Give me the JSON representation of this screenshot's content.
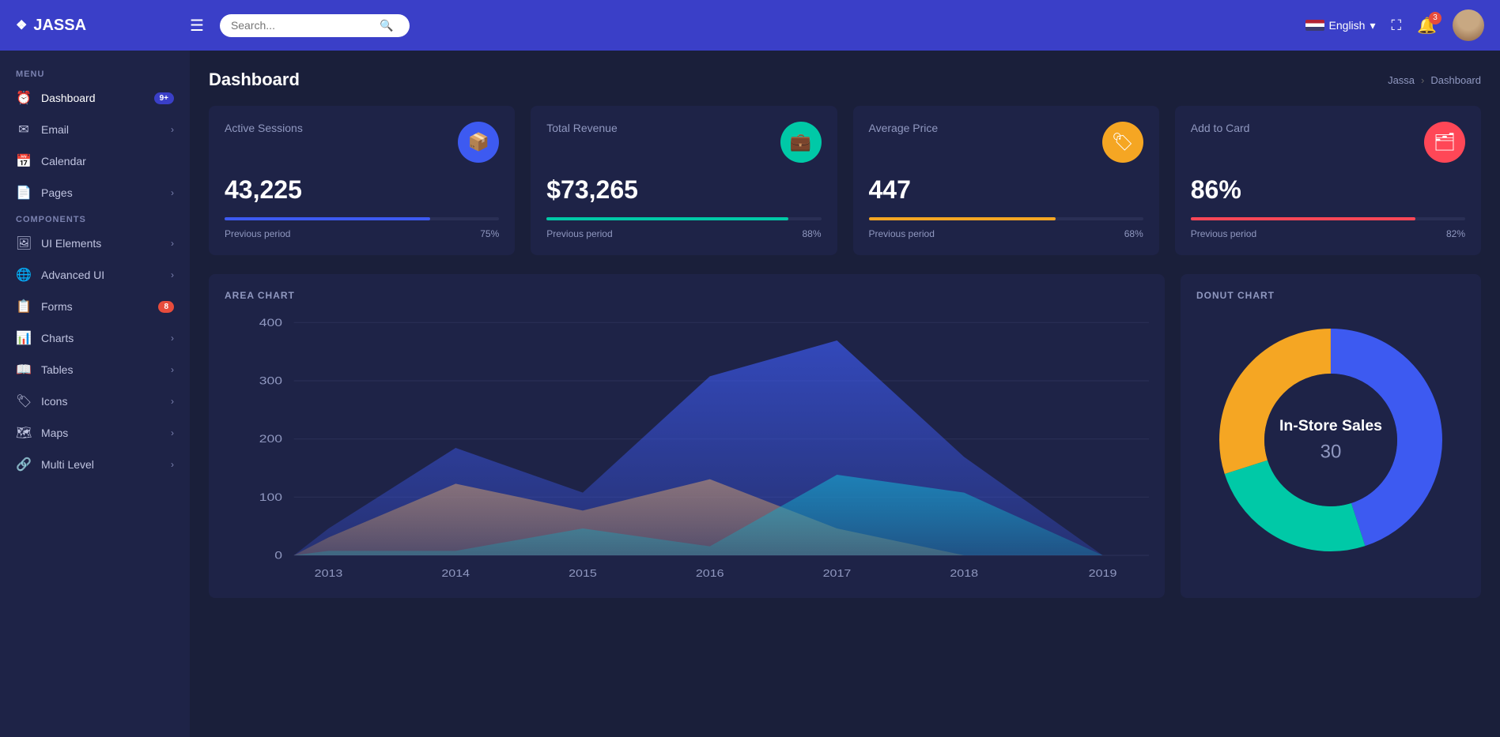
{
  "brand": {
    "icon": "❖",
    "name": "JASSA"
  },
  "topnav": {
    "menu_icon": "☰",
    "search_placeholder": "Search...",
    "lang_label": "English",
    "notif_count": "3",
    "fullscreen_icon": "⛶"
  },
  "sidebar": {
    "menu_label": "MENU",
    "components_label": "COMPONENTS",
    "items_menu": [
      {
        "id": "dashboard",
        "icon": "⏰",
        "label": "Dashboard",
        "badge": "9+",
        "badge_color": "blue",
        "arrow": false
      },
      {
        "id": "email",
        "icon": "✉",
        "label": "Email",
        "badge": null,
        "arrow": true
      },
      {
        "id": "calendar",
        "icon": "📅",
        "label": "Calendar",
        "badge": null,
        "arrow": false
      },
      {
        "id": "pages",
        "icon": "📄",
        "label": "Pages",
        "badge": null,
        "arrow": true
      }
    ],
    "items_components": [
      {
        "id": "ui-elements",
        "icon": "🖼",
        "label": "UI Elements",
        "badge": null,
        "arrow": true
      },
      {
        "id": "advanced-ui",
        "icon": "🌐",
        "label": "Advanced UI",
        "badge": null,
        "arrow": true
      },
      {
        "id": "forms",
        "icon": "📋",
        "label": "Forms",
        "badge": "8",
        "badge_color": "red",
        "arrow": false
      },
      {
        "id": "charts",
        "icon": "📊",
        "label": "Charts",
        "badge": null,
        "arrow": true
      },
      {
        "id": "tables",
        "icon": "📖",
        "label": "Tables",
        "badge": null,
        "arrow": true
      },
      {
        "id": "icons",
        "icon": "🏷",
        "label": "Icons",
        "badge": null,
        "arrow": true
      },
      {
        "id": "maps",
        "icon": "🗺",
        "label": "Maps",
        "badge": null,
        "arrow": true
      },
      {
        "id": "multi-level",
        "icon": "🔗",
        "label": "Multi Level",
        "badge": null,
        "arrow": true
      }
    ]
  },
  "page": {
    "title": "Dashboard",
    "breadcrumb_home": "Jassa",
    "breadcrumb_sep": "›",
    "breadcrumb_current": "Dashboard"
  },
  "stat_cards": [
    {
      "label": "Active Sessions",
      "value": "43,225",
      "icon": "📦",
      "icon_bg": "#3d5af1",
      "progress": 75,
      "progress_color": "#3d5af1",
      "prev_label": "Previous period",
      "prev_pct": "75%"
    },
    {
      "label": "Total Revenue",
      "value": "$73,265",
      "icon": "💼",
      "icon_bg": "#00c9a7",
      "progress": 88,
      "progress_color": "#00c9a7",
      "prev_label": "Previous period",
      "prev_pct": "88%"
    },
    {
      "label": "Average Price",
      "value": "447",
      "icon": "🏷",
      "icon_bg": "#f5a623",
      "progress": 68,
      "progress_color": "#f5a623",
      "prev_label": "Previous period",
      "prev_pct": "68%"
    },
    {
      "label": "Add to Card",
      "value": "86%",
      "icon": "🗂",
      "icon_bg": "#ff4757",
      "progress": 82,
      "progress_color": "#ff4757",
      "prev_label": "Previous period",
      "prev_pct": "82%"
    }
  ],
  "area_chart": {
    "title": "AREA CHART",
    "y_labels": [
      "400",
      "300",
      "200",
      "100",
      "0"
    ],
    "x_labels": [
      "2013",
      "2014",
      "2015",
      "2016",
      "2017",
      "2018",
      "2019"
    ]
  },
  "donut_chart": {
    "title": "DONUT CHART",
    "center_label": "In-Store Sales",
    "center_value": "30",
    "segments": [
      {
        "label": "Blue",
        "color": "#3d5af1",
        "value": 45
      },
      {
        "label": "Green",
        "color": "#00c9a7",
        "value": 25
      },
      {
        "label": "Yellow",
        "color": "#f5a623",
        "value": 30
      }
    ]
  }
}
